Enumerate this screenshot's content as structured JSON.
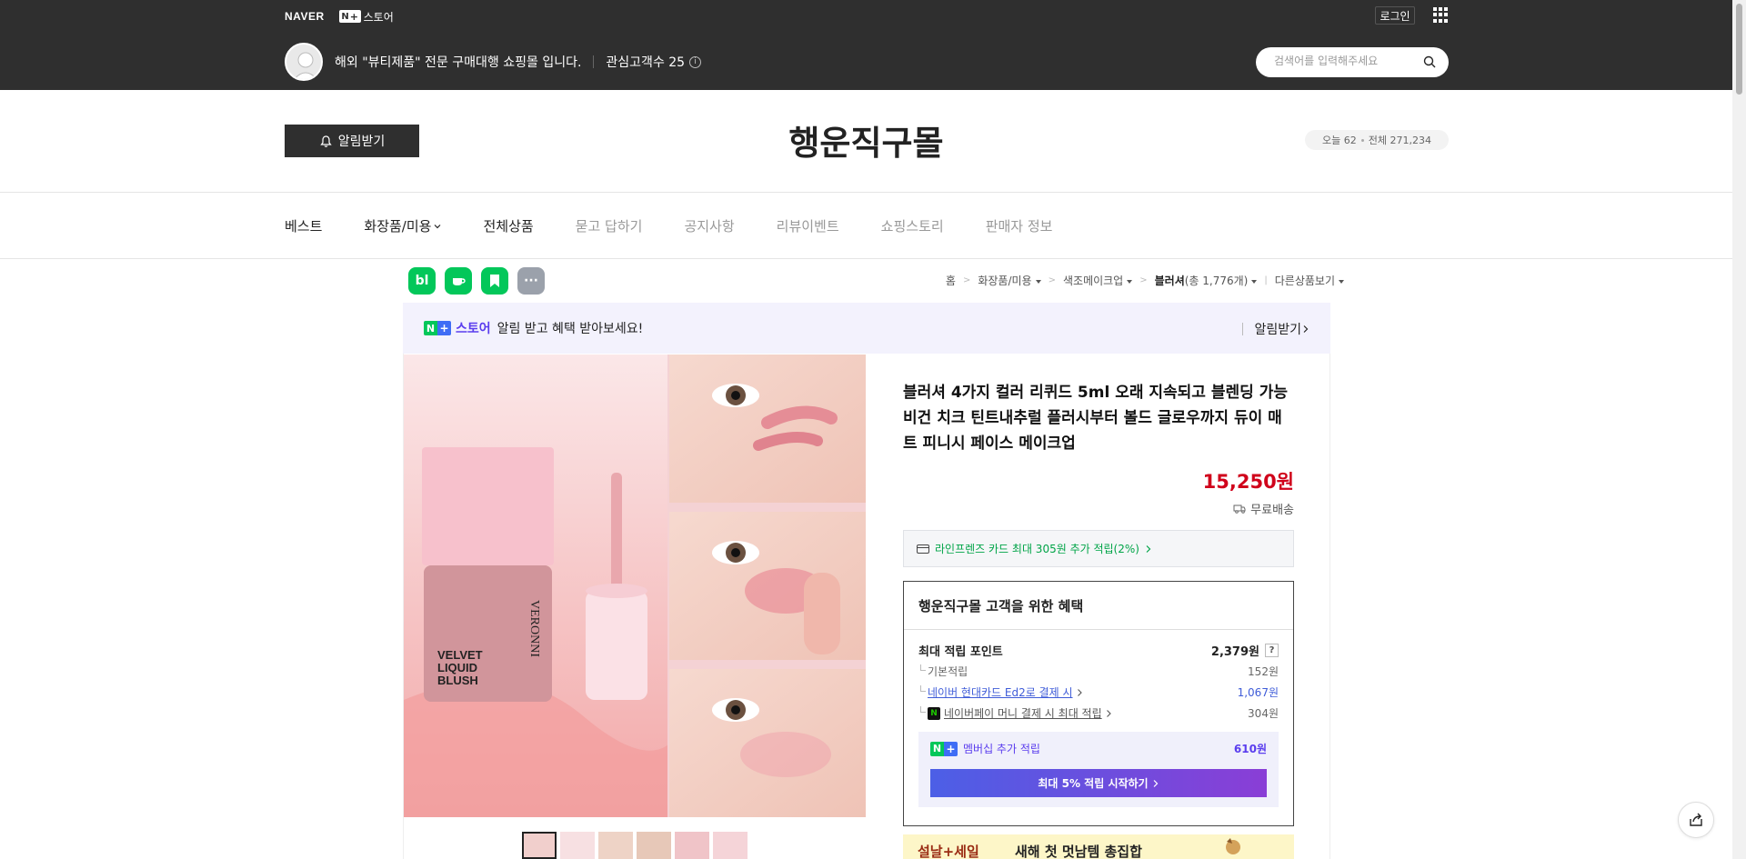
{
  "topbar": {
    "naver_label": "NAVER",
    "nplus_store_label": "스토어",
    "login_label": "로그인",
    "store_description": "해외 \"뷰티제품\" 전문 구매대행 쇼핑몰 입니다.",
    "interest_label": "관심고객수 25",
    "search_placeholder": "검색어를 입력해주세요"
  },
  "header": {
    "alarm_button": "알림받기",
    "shop_name": "행운직구몰",
    "visit_today": "오늘 62",
    "visit_total": "전체 271,234"
  },
  "nav": {
    "items": [
      {
        "label": "베스트"
      },
      {
        "label": "화장품/미용"
      },
      {
        "label": "전체상품"
      },
      {
        "label": "묻고 답하기"
      },
      {
        "label": "공지사항"
      },
      {
        "label": "리뷰이벤트"
      },
      {
        "label": "쇼핑스토리"
      },
      {
        "label": "판매자 정보"
      }
    ]
  },
  "breadcrumb": {
    "home": "홈",
    "cat1": "화장품/미용",
    "cat2": "색조메이크업",
    "cat3": "블러셔",
    "cat3_count": "(총 1,776개)",
    "other": "다른상품보기"
  },
  "promo": {
    "store_label": "스토어",
    "text": "알림 받고 혜택 받아보세요!",
    "action": "알림받기"
  },
  "product": {
    "title": "블러셔 4가지 컬러 리퀴드 5ml 오래 지속되고 블렌딩 가능 비건 치크 틴트내추럴 플러시부터 볼드 글로우까지 듀이 매트 피니시 페이스 메이크업",
    "price": "15,250원",
    "shipping": "무료배송",
    "card_benefit": "라인프렌즈 카드 최대 305원 추가 적립(2%)",
    "image_text": {
      "brand": "VERONNI",
      "line1": "VELVET",
      "line2": "LIQUID",
      "line3": "BLUSH"
    }
  },
  "benefits": {
    "title": "행운직구몰 고객을 위한 혜택",
    "max_points_label": "최대 적립 포인트",
    "max_points_value": "2,379원",
    "qmark": "?",
    "rows": [
      {
        "label": "기본적립",
        "value": "152원"
      },
      {
        "label": "네이버 현대카드 Ed2로 결제 시",
        "value": "1,067원"
      },
      {
        "label": "네이버페이 머니 결제 시 최대 적립",
        "value": "304원"
      }
    ],
    "membership_label": "멤버십 추가 적립",
    "membership_value": "610원",
    "membership_button": "최대 5% 적립 시작하기"
  },
  "event_banner": {
    "text1": "설날+세일",
    "text2": "새해 첫 멋남템 총집합"
  },
  "colors": {
    "accent_purple": "#5a3dee",
    "price_red": "#d0021b",
    "naver_green": "#03c75a",
    "topbar": "#2f2f2f"
  }
}
